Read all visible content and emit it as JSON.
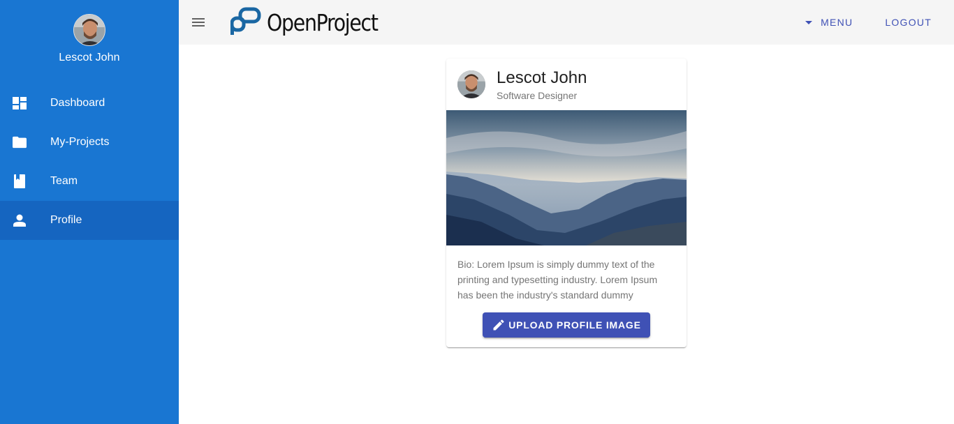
{
  "app": {
    "brand_name": "OpenProject",
    "accent_color": "#3f51b5",
    "sidebar_color": "#1976d2"
  },
  "sidebar": {
    "user_name": "Lescot John",
    "items": [
      {
        "label": "Dashboard",
        "icon": "dashboard-icon",
        "active": false
      },
      {
        "label": "My-Projects",
        "icon": "folder-icon",
        "active": false
      },
      {
        "label": "Team",
        "icon": "book-icon",
        "active": false
      },
      {
        "label": "Profile",
        "icon": "person-icon",
        "active": true
      }
    ]
  },
  "topbar": {
    "menu_icon": "hamburger-menu-icon",
    "menu_label": "MENU",
    "logout_label": "LOGOUT"
  },
  "profile_card": {
    "name": "Lescot John",
    "role": "Software Designer",
    "bio": "Bio: Lorem Ipsum is simply dummy text of the printing and typesetting industry. Lorem Ipsum has been the industry's standard dummy",
    "upload_label": "UPLOAD PROFILE IMAGE",
    "upload_icon": "pencil-icon"
  }
}
